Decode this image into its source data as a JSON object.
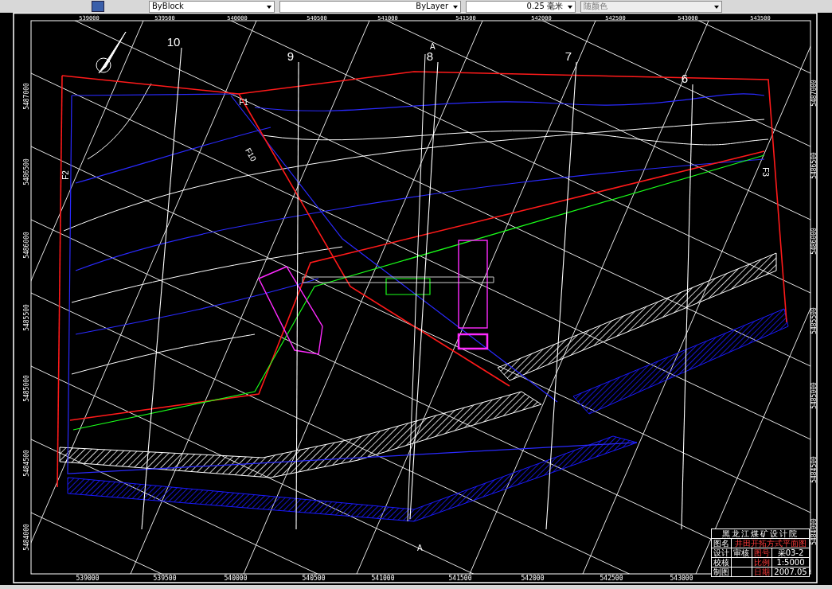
{
  "toolbar": {
    "dropdowns": [
      {
        "kind": "linetype",
        "value": "ByBlock"
      },
      {
        "kind": "lineweight-name",
        "value": "ByLayer"
      },
      {
        "kind": "lineweight",
        "value": "0.25 毫米"
      },
      {
        "kind": "plotstyle",
        "value": "随颜色"
      }
    ]
  },
  "drawing": {
    "top_coordinates": [
      "539000",
      "539500",
      "540000",
      "540500",
      "541000",
      "541500",
      "542000",
      "542500",
      "543000",
      "543500"
    ],
    "bottom_coordinates": [
      "539000",
      "539500",
      "540000",
      "540500",
      "541000",
      "541500",
      "542000",
      "542500",
      "543000"
    ],
    "left_coordinates": [
      "5487000",
      "5486500",
      "5486000",
      "5485500",
      "5485000",
      "5484500",
      "5484000"
    ],
    "right_coordinates": [
      "5487000",
      "5486500",
      "5486000",
      "5485500",
      "5485000",
      "5484500",
      "5484000"
    ],
    "section_lines": [
      "10",
      "9",
      "8",
      "7",
      "6"
    ],
    "profile_line": {
      "top_label": "A",
      "bottom_label": "A"
    },
    "faults": [
      "F1",
      "F10",
      "F2",
      "F3"
    ]
  },
  "title_block": {
    "organization": "黑龙江煤矿设计院",
    "rows": [
      {
        "label": "图名",
        "value": "井田开拓方式平面图"
      },
      {
        "label": "设计",
        "value": "审核",
        "label2": "图号",
        "value2": "采03-2"
      },
      {
        "label": "校核",
        "value": "",
        "label2": "比例",
        "value2": "1:5000"
      },
      {
        "label": "制图",
        "value": "",
        "label2": "日期",
        "value2": "2007.05"
      }
    ]
  }
}
